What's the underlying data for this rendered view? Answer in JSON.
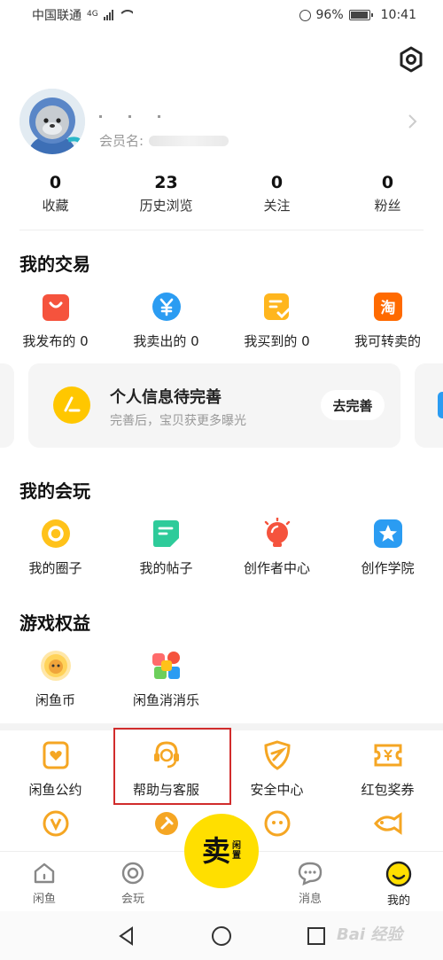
{
  "status_bar": {
    "carrier": "中国联通",
    "network": "4G",
    "battery": "96%",
    "battery_level": 0.96,
    "time": "10:41"
  },
  "profile": {
    "member_label": "会员名:"
  },
  "stats": [
    {
      "value": "0",
      "label": "收藏"
    },
    {
      "value": "23",
      "label": "历史浏览"
    },
    {
      "value": "0",
      "label": "关注"
    },
    {
      "value": "0",
      "label": "粉丝"
    }
  ],
  "my_trades": {
    "title": "我的交易",
    "items": [
      {
        "label": "我发布的 0",
        "icon": "shopping-bag-icon",
        "color": "#f5533d"
      },
      {
        "label": "我卖出的 0",
        "icon": "yen-icon",
        "color": "#2b9cf2"
      },
      {
        "label": "我买到的 0",
        "icon": "checklist-icon",
        "color": "#ffb61e"
      },
      {
        "label": "我可转卖的",
        "icon": "taobao-icon",
        "color": "#ff6a00"
      }
    ]
  },
  "info_card": {
    "title": "个人信息待完善",
    "subtitle": "完善后，宝贝获更多曝光",
    "button": "去完善"
  },
  "my_play": {
    "title": "我的会玩",
    "items": [
      {
        "label": "我的圈子",
        "icon": "circle-icon",
        "color": "#ffc21a"
      },
      {
        "label": "我的帖子",
        "icon": "post-icon",
        "color": "#2ecb9a"
      },
      {
        "label": "创作者中心",
        "icon": "bulb-icon",
        "color": "#f5533d"
      },
      {
        "label": "创作学院",
        "icon": "star-icon",
        "color": "#2b9cf2"
      }
    ]
  },
  "game_rights": {
    "title": "游戏权益",
    "items": [
      {
        "label": "闲鱼币",
        "icon": "coin-icon"
      },
      {
        "label": "闲鱼消消乐",
        "icon": "puzzle-icon"
      }
    ]
  },
  "tools": {
    "items": [
      {
        "label": "闲鱼公约",
        "icon": "heart-card-icon"
      },
      {
        "label": "帮助与客服",
        "icon": "headset-icon"
      },
      {
        "label": "安全中心",
        "icon": "shield-icon"
      },
      {
        "label": "红包奖券",
        "icon": "coupon-icon"
      }
    ],
    "partial_icons": [
      "v-badge-icon",
      "hammer-icon",
      "monkey-icon",
      "fish-icon"
    ]
  },
  "bottom_nav": {
    "items": [
      {
        "label": "闲鱼",
        "icon": "home-icon"
      },
      {
        "label": "会玩",
        "icon": "ring-icon"
      },
      {
        "label": "消息",
        "icon": "message-icon"
      },
      {
        "label": "我的",
        "icon": "smile-icon"
      }
    ],
    "sell_main": "卖",
    "sell_side_1": "闲",
    "sell_side_2": "置",
    "accent": "#ffdf00"
  },
  "watermark": "Bai 经验"
}
